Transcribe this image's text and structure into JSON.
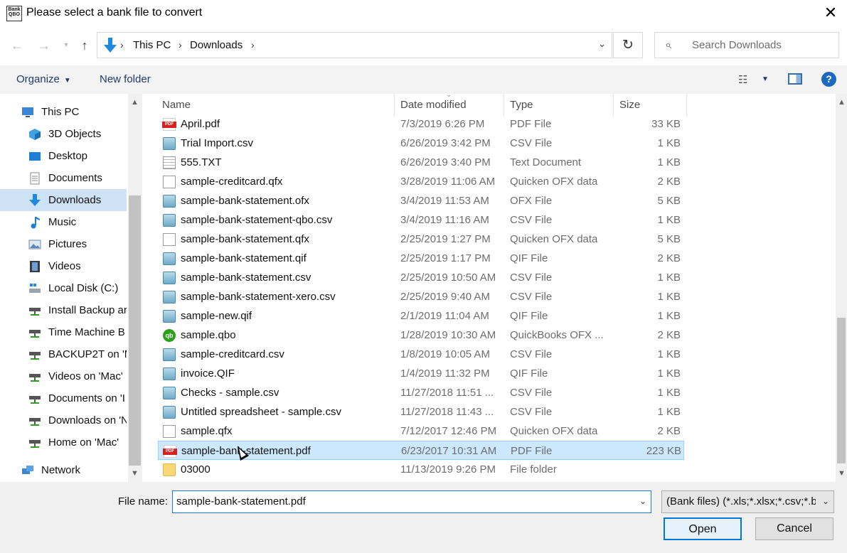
{
  "window": {
    "title": "Please select a bank file to convert",
    "app_icon_text": "Bank QBO",
    "close_glyph": "✕"
  },
  "address": {
    "crumbs": [
      "This PC",
      "Downloads"
    ],
    "search_placeholder": "Search Downloads"
  },
  "toolbar": {
    "organize": "Organize",
    "new_folder": "New folder",
    "help": "?"
  },
  "nav": {
    "items": [
      {
        "label": "This PC",
        "icon": "pc-icon"
      },
      {
        "label": "3D Objects",
        "icon": "cube-icon"
      },
      {
        "label": "Desktop",
        "icon": "desktop-icon"
      },
      {
        "label": "Documents",
        "icon": "documents-icon"
      },
      {
        "label": "Downloads",
        "icon": "download-arrow-icon"
      },
      {
        "label": "Music",
        "icon": "music-note-icon"
      },
      {
        "label": "Pictures",
        "icon": "pictures-icon"
      },
      {
        "label": "Videos",
        "icon": "film-icon"
      },
      {
        "label": "Local Disk (C:)",
        "icon": "disk-icon"
      },
      {
        "label": "Install Backup ar",
        "icon": "network-drive-icon"
      },
      {
        "label": "Time Machine B",
        "icon": "network-drive-icon"
      },
      {
        "label": "BACKUP2T on 'M",
        "icon": "network-drive-icon"
      },
      {
        "label": "Videos on 'Mac'",
        "icon": "network-drive-icon"
      },
      {
        "label": "Documents on 'I",
        "icon": "network-drive-icon"
      },
      {
        "label": "Downloads on 'N",
        "icon": "network-drive-icon"
      },
      {
        "label": "Home on 'Mac'",
        "icon": "network-drive-icon"
      },
      {
        "label": "Network",
        "icon": "network-icon"
      }
    ],
    "selected": "Downloads"
  },
  "columns": {
    "name": "Name",
    "date": "Date modified",
    "type": "Type",
    "size": "Size"
  },
  "files": [
    {
      "name": "April.pdf",
      "date": "7/3/2019 6:26 PM",
      "type": "PDF File",
      "size": "33 KB",
      "icon": "pdf"
    },
    {
      "name": "Trial Import.csv",
      "date": "6/26/2019 3:42 PM",
      "type": "CSV File",
      "size": "1 KB",
      "icon": "csv"
    },
    {
      "name": "555.TXT",
      "date": "6/26/2019 3:40 PM",
      "type": "Text Document",
      "size": "1 KB",
      "icon": "txt"
    },
    {
      "name": "sample-creditcard.qfx",
      "date": "3/28/2019 11:06 AM",
      "type": "Quicken OFX data",
      "size": "2 KB",
      "icon": "doc"
    },
    {
      "name": "sample-bank-statement.ofx",
      "date": "3/4/2019 11:53 AM",
      "type": "OFX File",
      "size": "5 KB",
      "icon": "csv"
    },
    {
      "name": "sample-bank-statement-qbo.csv",
      "date": "3/4/2019 11:16 AM",
      "type": "CSV File",
      "size": "1 KB",
      "icon": "csv"
    },
    {
      "name": "sample-bank-statement.qfx",
      "date": "2/25/2019 1:27 PM",
      "type": "Quicken OFX data",
      "size": "5 KB",
      "icon": "doc"
    },
    {
      "name": "sample-bank-statement.qif",
      "date": "2/25/2019 1:17 PM",
      "type": "QIF File",
      "size": "2 KB",
      "icon": "csv"
    },
    {
      "name": "sample-bank-statement.csv",
      "date": "2/25/2019 10:50 AM",
      "type": "CSV File",
      "size": "1 KB",
      "icon": "csv"
    },
    {
      "name": "sample-bank-statement-xero.csv",
      "date": "2/25/2019 9:40 AM",
      "type": "CSV File",
      "size": "1 KB",
      "icon": "csv"
    },
    {
      "name": "sample-new.qif",
      "date": "2/1/2019 11:04 AM",
      "type": "QIF File",
      "size": "1 KB",
      "icon": "csv"
    },
    {
      "name": "sample.qbo",
      "date": "1/28/2019 10:30 AM",
      "type": "QuickBooks OFX ...",
      "size": "2 KB",
      "icon": "qb"
    },
    {
      "name": "sample-creditcard.csv",
      "date": "1/8/2019 10:05 AM",
      "type": "CSV File",
      "size": "1 KB",
      "icon": "csv"
    },
    {
      "name": "invoice.QIF",
      "date": "1/4/2019 11:32 PM",
      "type": "QIF File",
      "size": "1 KB",
      "icon": "csv"
    },
    {
      "name": "Checks - sample.csv",
      "date": "11/27/2018 11:51 ...",
      "type": "CSV File",
      "size": "1 KB",
      "icon": "csv"
    },
    {
      "name": "Untitled spreadsheet - sample.csv",
      "date": "11/27/2018 11:43 ...",
      "type": "CSV File",
      "size": "1 KB",
      "icon": "csv"
    },
    {
      "name": "sample.qfx",
      "date": "7/12/2017 12:46 PM",
      "type": "Quicken OFX data",
      "size": "2 KB",
      "icon": "doc"
    },
    {
      "name": "sample-bank-statement.pdf",
      "date": "6/23/2017 10:31 AM",
      "type": "PDF File",
      "size": "223 KB",
      "icon": "pdf",
      "selected": true
    },
    {
      "name": "03000",
      "date": "11/13/2019 9:26 PM",
      "type": "File folder",
      "size": "",
      "icon": "folder"
    }
  ],
  "footer": {
    "file_name_label": "File name:",
    "file_name_value": "sample-bank-statement.pdf",
    "filter_value": "(Bank files) (*.xls;*.xlsx;*.csv;*.b",
    "open_label": "Open",
    "cancel_label": "Cancel"
  },
  "colors": {
    "selection": "#cce8ff",
    "nav_selection": "#cde2f5",
    "accent": "#0078d7"
  }
}
